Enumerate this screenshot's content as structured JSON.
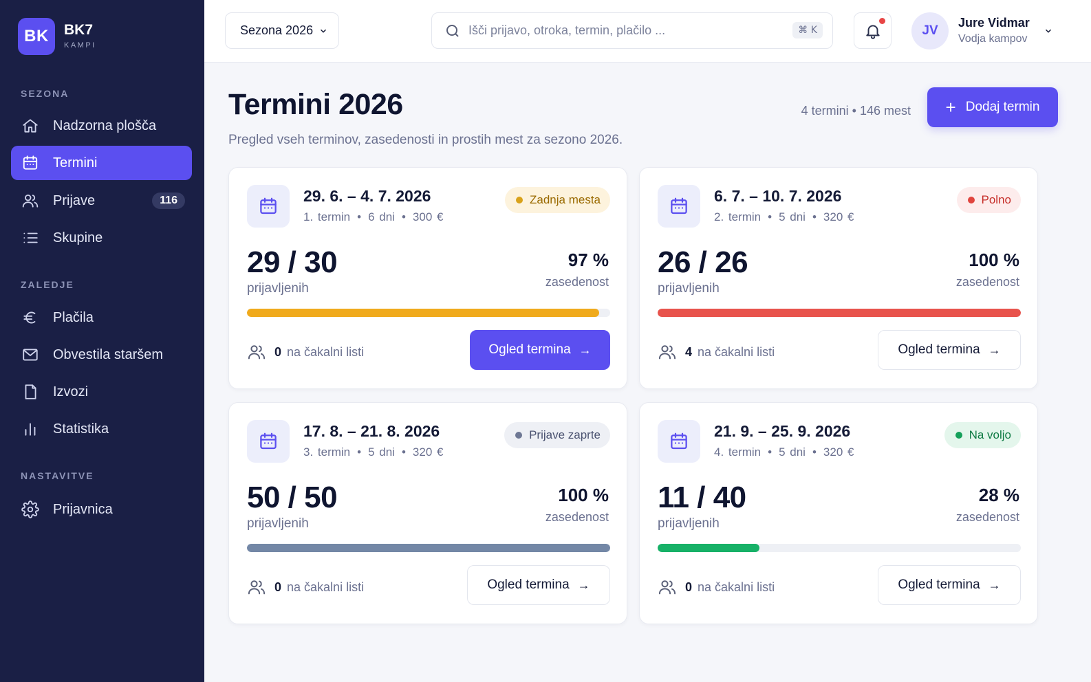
{
  "brand": {
    "logo": "BK",
    "name": "BK7",
    "subtitle": "KAMPI"
  },
  "sidebar": {
    "sections": [
      {
        "label": "SEZONA"
      },
      {
        "label": "ZALEDJE"
      },
      {
        "label": "NASTAVITVE"
      }
    ],
    "items": [
      {
        "label": "Nadzorna plošča",
        "icon": "home-icon",
        "active": false
      },
      {
        "label": "Termini",
        "icon": "calendar-icon",
        "active": true
      },
      {
        "label": "Prijave",
        "icon": "users-icon",
        "active": false,
        "badge": "116"
      },
      {
        "label": "Skupine",
        "icon": "list-icon",
        "active": false
      },
      {
        "label": "Plačila",
        "icon": "euro-icon",
        "active": false
      },
      {
        "label": "Obvestila staršem",
        "icon": "mail-icon",
        "active": false
      },
      {
        "label": "Izvozi",
        "icon": "file-icon",
        "active": false
      },
      {
        "label": "Statistika",
        "icon": "bar-chart-icon",
        "active": false
      },
      {
        "label": "Prijavnica",
        "icon": "gear-icon",
        "active": false
      }
    ]
  },
  "topbar": {
    "season": "Sezona 2026",
    "search_placeholder": "Išči prijavo, otroka, termin, plačilo ...",
    "shortcut": "⌘ K",
    "notifications_unread": true,
    "user": {
      "initials": "JV",
      "name": "Jure Vidmar",
      "role": "Vodja kampov"
    }
  },
  "header": {
    "title": "Termini 2026",
    "subtitle": "Pregled vseh terminov, zasedenosti in prostih mest za sezono 2026.",
    "summary": "4 termini • 146 mest",
    "add_button": "Dodaj termin"
  },
  "labels": {
    "registered": "prijavljenih",
    "occupancy": "zasedenost",
    "waitlist": "na čakalni listi",
    "view_button": "Ogled termina"
  },
  "terms": [
    {
      "date": "29. 6. – 4. 7. 2026",
      "number": "1. termin",
      "duration": "6 dni",
      "price": "300 €",
      "status": "Zadnja mesta",
      "status_color": "#d9a21a",
      "status_bg": "#fdf3dd",
      "status_text": "#9a6a00",
      "count": "29 / 30",
      "percent": "97 %",
      "fill": 0.97,
      "bar_color": "#f0aa1c",
      "waitlist": "0",
      "primary": true
    },
    {
      "date": "6. 7. – 10. 7. 2026",
      "number": "2. termin",
      "duration": "5 dni",
      "price": "320 €",
      "status": "Polno",
      "status_color": "#e0443e",
      "status_bg": "#fdecec",
      "status_text": "#c62d28",
      "count": "26 / 26",
      "percent": "100 %",
      "fill": 1.0,
      "bar_color": "#e8534c",
      "waitlist": "4",
      "primary": false
    },
    {
      "date": "17. 8. – 21. 8. 2026",
      "number": "3. termin",
      "duration": "5 dni",
      "price": "320 €",
      "status": "Prijave zaprte",
      "status_color": "#6e7894",
      "status_bg": "#eef0f5",
      "status_text": "#4a5270",
      "count": "50 / 50",
      "percent": "100 %",
      "fill": 1.0,
      "bar_color": "#7387a6",
      "waitlist": "0",
      "primary": false
    },
    {
      "date": "21. 9. – 25. 9. 2026",
      "number": "4. termin",
      "duration": "5 dni",
      "price": "320 €",
      "status": "Na voljo",
      "status_color": "#15a05a",
      "status_bg": "#e4f6ec",
      "status_text": "#0e7a43",
      "count": "11 / 40",
      "percent": "28 %",
      "fill": 0.28,
      "bar_color": "#17b167",
      "waitlist": "0",
      "primary": false
    }
  ]
}
